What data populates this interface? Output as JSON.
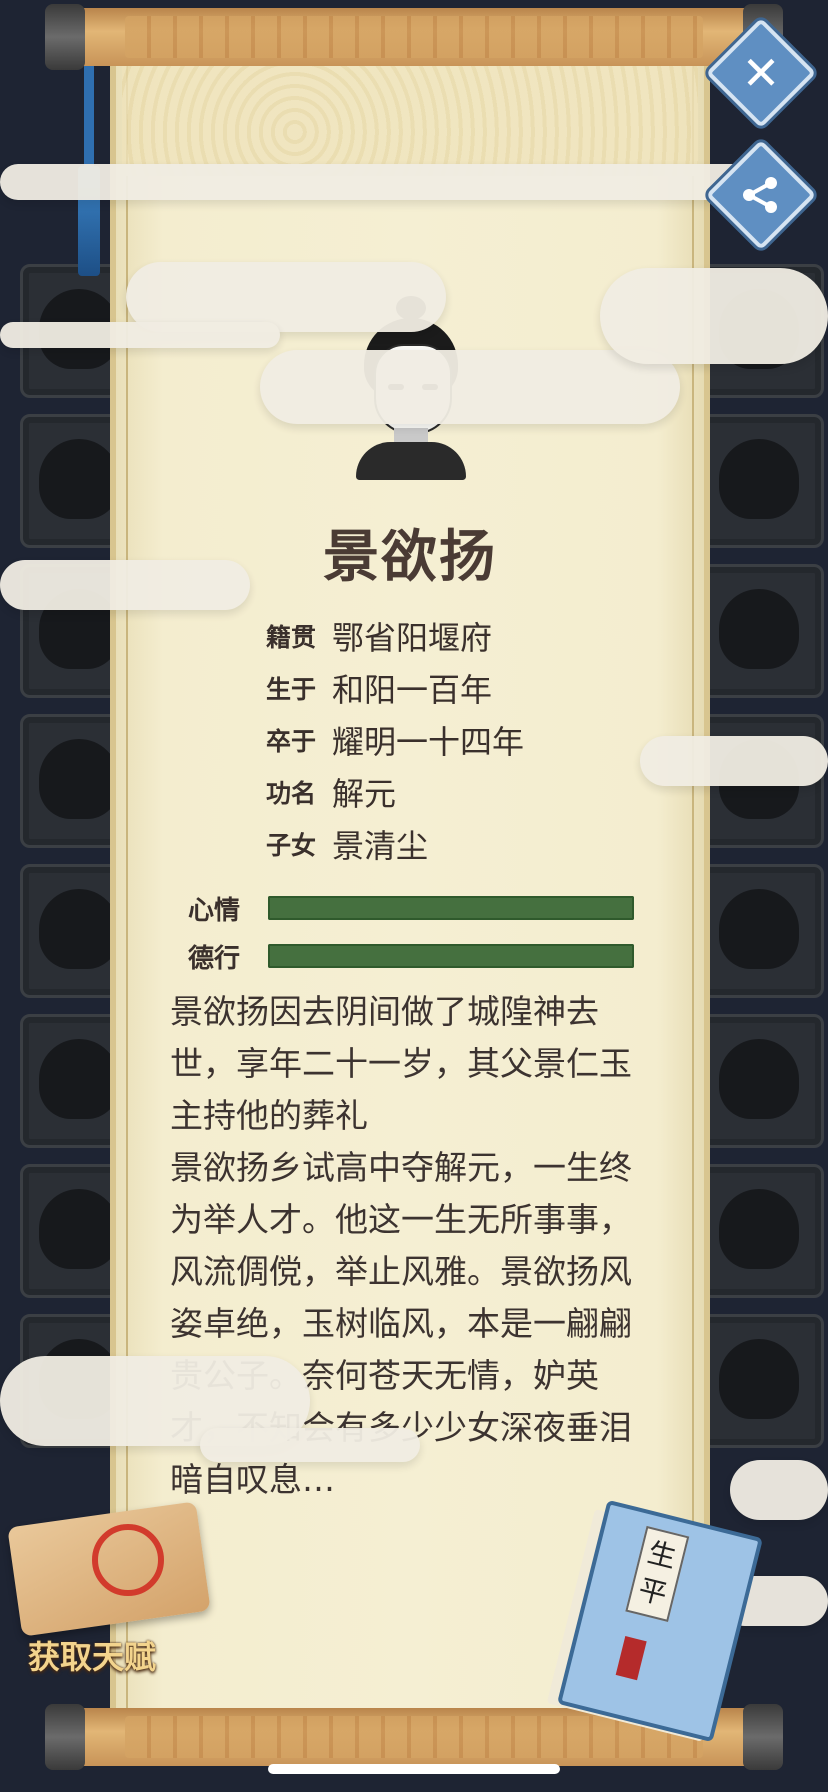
{
  "character": {
    "name": "景欲扬",
    "info": [
      {
        "key": "籍贯",
        "value": "鄂省阳堰府"
      },
      {
        "key": "生于",
        "value": "和阳一百年"
      },
      {
        "key": "卒于",
        "value": "耀明一十四年"
      },
      {
        "key": "功名",
        "value": "解元"
      },
      {
        "key": "子女",
        "value": "景清尘"
      }
    ],
    "stats": [
      {
        "label": "心情",
        "value": 1.0
      },
      {
        "label": "德行",
        "value": 1.0
      }
    ],
    "bio": [
      "景欲扬因去阴间做了城隍神去世，享年二十一岁，其父景仁玉主持他的葬礼",
      "景欲扬乡试高中夺解元，一生终为举人才。他这一生无所事事，风流倜傥，举止风雅。景欲扬风姿卓绝，玉树临风，本是一翩翩贵公子。奈何苍天无情，妒英才，不知会有多少少女深夜垂泪暗自叹息…"
    ]
  },
  "buttons": {
    "close_icon": "close-icon",
    "share_icon": "share-icon",
    "talent_label": "获取天赋"
  },
  "book": {
    "title": "生平"
  },
  "colors": {
    "stat_bar": "#45703f",
    "name": "#4a3b34",
    "button": "#5f8fc2"
  }
}
